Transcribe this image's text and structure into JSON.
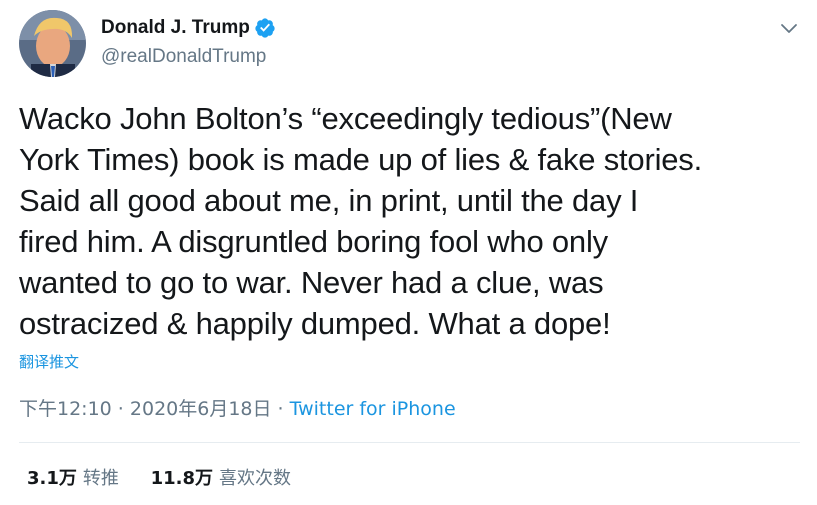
{
  "author": {
    "display_name": "Donald J. Trump",
    "handle": "@realDonaldTrump",
    "avatar_icon": "profile-photo",
    "verified_icon": "verified-badge-icon",
    "menu_icon": "chevron-down-icon"
  },
  "tweet": {
    "text": "Wacko John Bolton’s “exceedingly tedious”(New\nYork Times) book is made up of lies & fake stories.\nSaid all good about me, in print, until the day I\nfired him. A disgruntled boring fool who only\nwanted to go to war. Never had a clue, was\nostracized & happily dumped. What a dope!",
    "translate_label": "翻译推文"
  },
  "meta": {
    "time": "下午12:10",
    "sep1": " · ",
    "date": "2020年6月18日",
    "sep2": " · ",
    "source": "Twitter for iPhone"
  },
  "stats": {
    "retweets_value": "3.1万",
    "retweets_label": "转推",
    "likes_value": "11.8万",
    "likes_label": "喜欢次数"
  },
  "colors": {
    "link": "#1b95e0",
    "muted": "#657786",
    "text": "#14171a",
    "divider": "#e6ecf0"
  }
}
